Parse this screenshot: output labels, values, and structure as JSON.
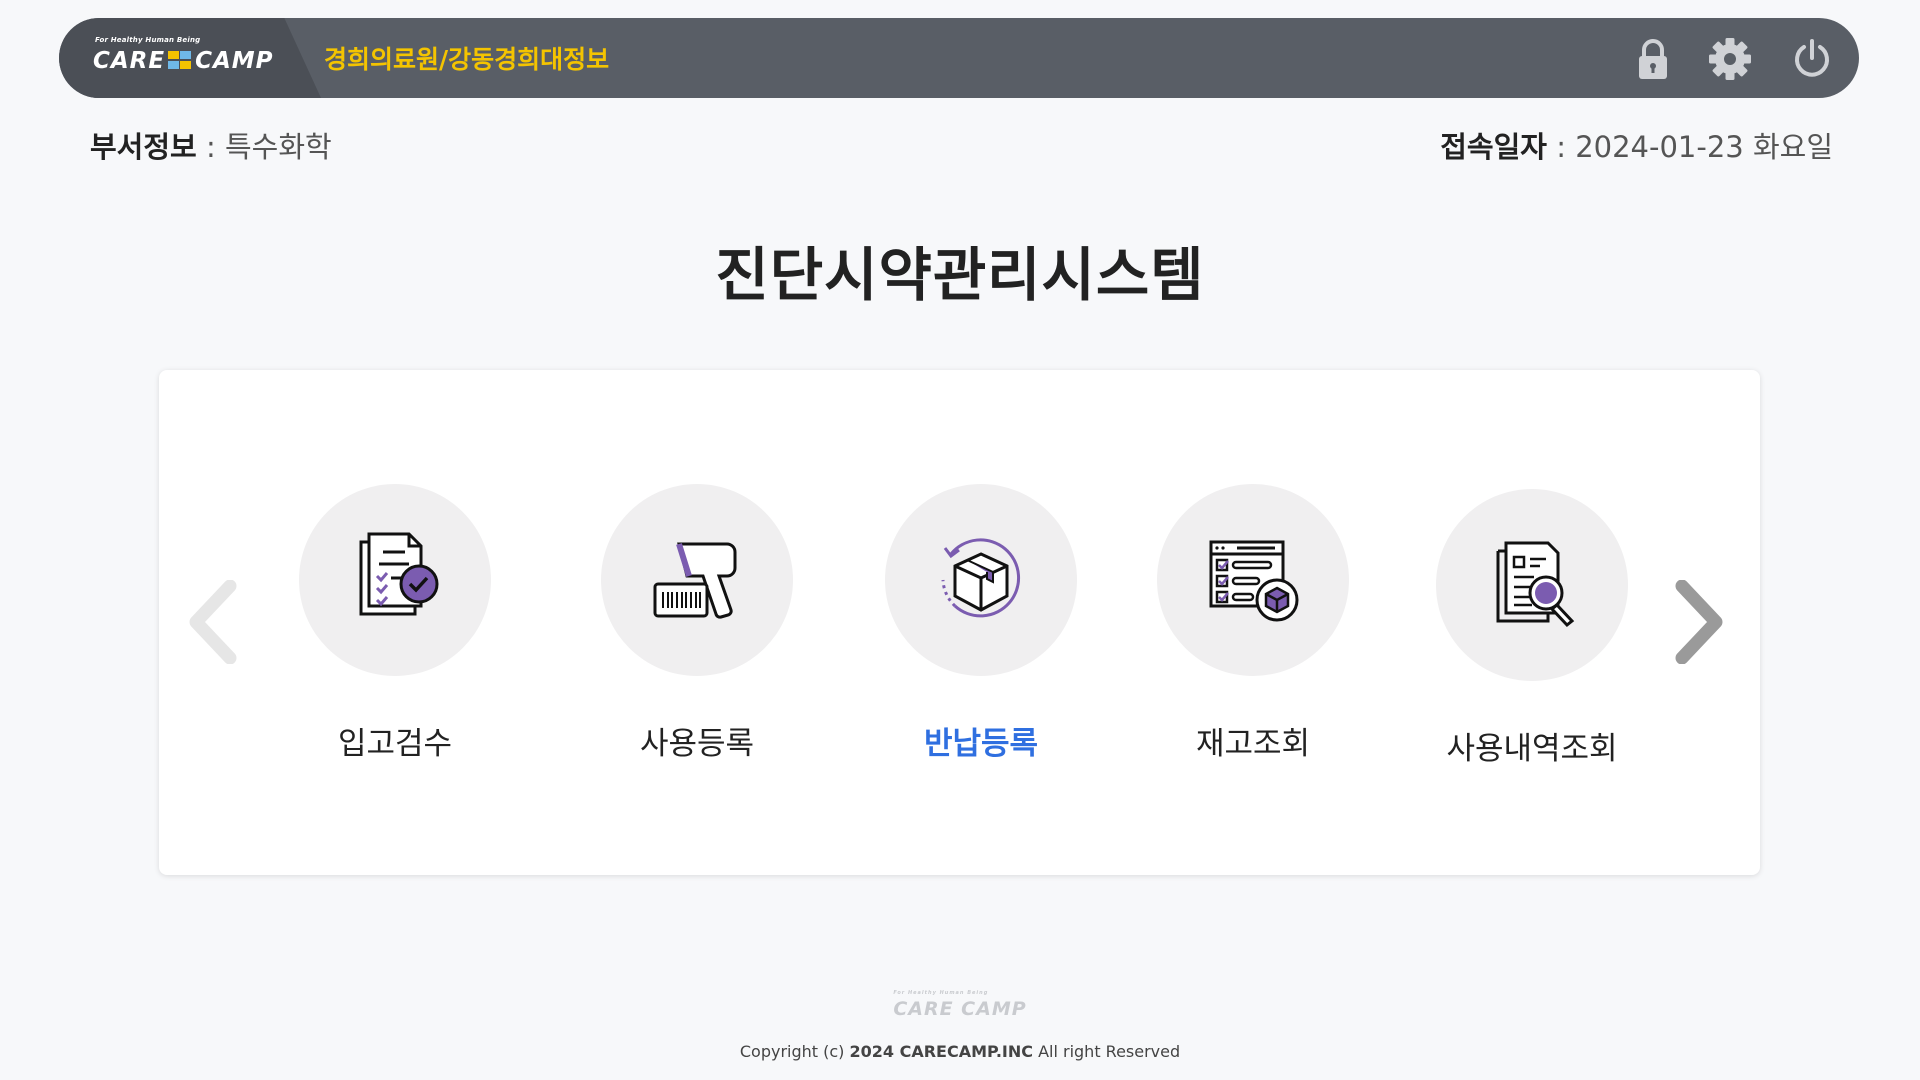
{
  "header": {
    "logo_tagline": "For Healthy Human Being",
    "logo_left": "CARE",
    "logo_right": "CAMP",
    "hospital": "경희의료원/강동경희대정보",
    "colors": {
      "bar": "#595e66",
      "accent": "#f4c400"
    },
    "icons": [
      "lock-icon",
      "gear-icon",
      "power-icon"
    ]
  },
  "info": {
    "dept_label": "부서정보",
    "dept_sep": " : ",
    "dept_value": "특수화학",
    "date_label": "접속일자",
    "date_sep": " : ",
    "date_value": "2024-01-23 화요일"
  },
  "title": "진단시약관리시스템",
  "menu": {
    "items": [
      {
        "label": "입고검수",
        "icon": "checklist-document-icon"
      },
      {
        "label": "사용등록",
        "icon": "barcode-scanner-icon"
      },
      {
        "label": "반납등록",
        "icon": "return-box-icon",
        "active": true
      },
      {
        "label": "재고조회",
        "icon": "inventory-list-icon"
      },
      {
        "label": "사용내역조회",
        "icon": "document-search-icon"
      }
    ],
    "active_color": "#2f6fe0",
    "icon_accent": "#7b5cb0"
  },
  "footer": {
    "logo": "CARE CAMP",
    "logo_tagline": "For Healthy Human Being",
    "copyright_prefix": "Copyright (c) ",
    "copyright_year_company": "2024 CARECAMP.INC",
    "copyright_suffix": " All right Reserved"
  }
}
